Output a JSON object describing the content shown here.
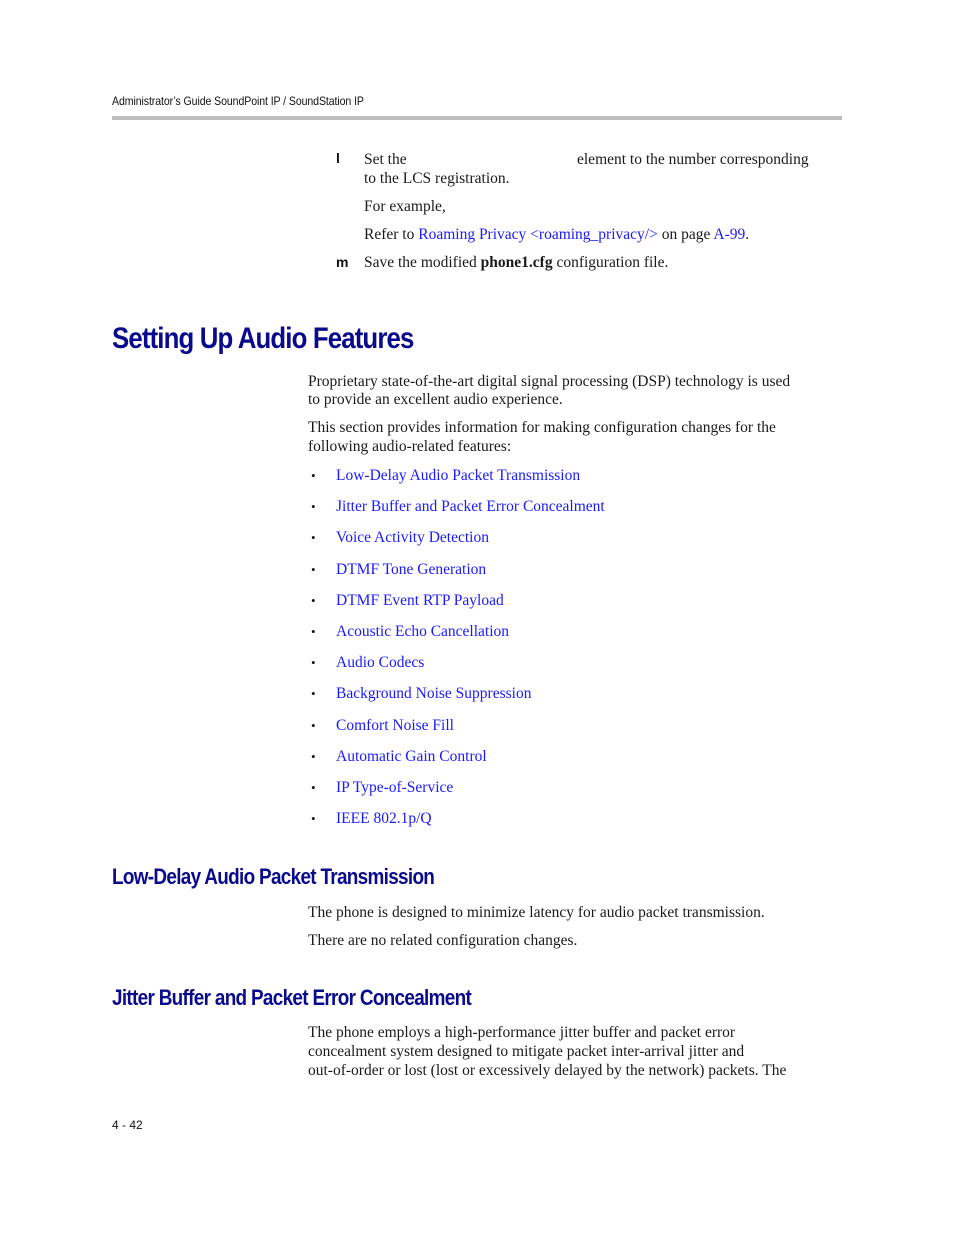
{
  "header": {
    "running_title": "Administrator’s Guide SoundPoint IP / SoundStation IP"
  },
  "steps": [
    {
      "label": "l",
      "line1_start": "Set the",
      "line1_end": "element to the number corresponding",
      "line2": "to the LCS registration.",
      "example": "For example,",
      "refer_prefix": "Refer to ",
      "refer_link": "Roaming Privacy <roaming_privacy/>",
      "refer_mid": " on page ",
      "refer_page_link": "A-99",
      "refer_suffix": "."
    },
    {
      "label": "m",
      "text_before": "Save the modified ",
      "bold": "phone1.cfg",
      "text_after": " configuration file."
    }
  ],
  "section_main": {
    "title": "Setting Up Audio Features",
    "para1": "Proprietary state-of-the-art digital signal processing (DSP) technology is used to provide an excellent audio experience.",
    "para1_line1": "Proprietary state-of-the-art digital signal processing (DSP) technology is used",
    "para1_line2": "to provide an excellent audio experience.",
    "para2_line1": "This section provides information for making configuration changes for the",
    "para2_line2": "following audio-related features:",
    "bullet_char": "•",
    "features": [
      "Low-Delay Audio Packet Transmission",
      "Jitter Buffer and Packet Error Concealment",
      "Voice Activity Detection",
      "DTMF Tone Generation",
      "DTMF Event RTP Payload",
      "Acoustic Echo Cancellation",
      "Audio Codecs",
      "Background Noise Suppression",
      "Comfort Noise Fill",
      "Automatic Gain Control",
      "IP Type-of-Service",
      "IEEE 802.1p/Q"
    ]
  },
  "section_low_delay": {
    "title": "Low-Delay Audio Packet Transmission",
    "para1": "The phone is designed to minimize latency for audio packet transmission.",
    "para2": "There are no related configuration changes."
  },
  "section_jitter": {
    "title": "Jitter Buffer and Packet Error Concealment",
    "line1": "The phone employs a high-performance jitter buffer and packet error",
    "line2": "concealment system designed to mitigate packet inter-arrival jitter and",
    "line3": "out-of-order or lost (lost or excessively delayed by the network) packets. The"
  },
  "footer": {
    "page_number": "4 - 42"
  },
  "colors": {
    "heading": "#0a0a8c",
    "link": "#1a1aff",
    "rule": "#bcbcbc"
  }
}
